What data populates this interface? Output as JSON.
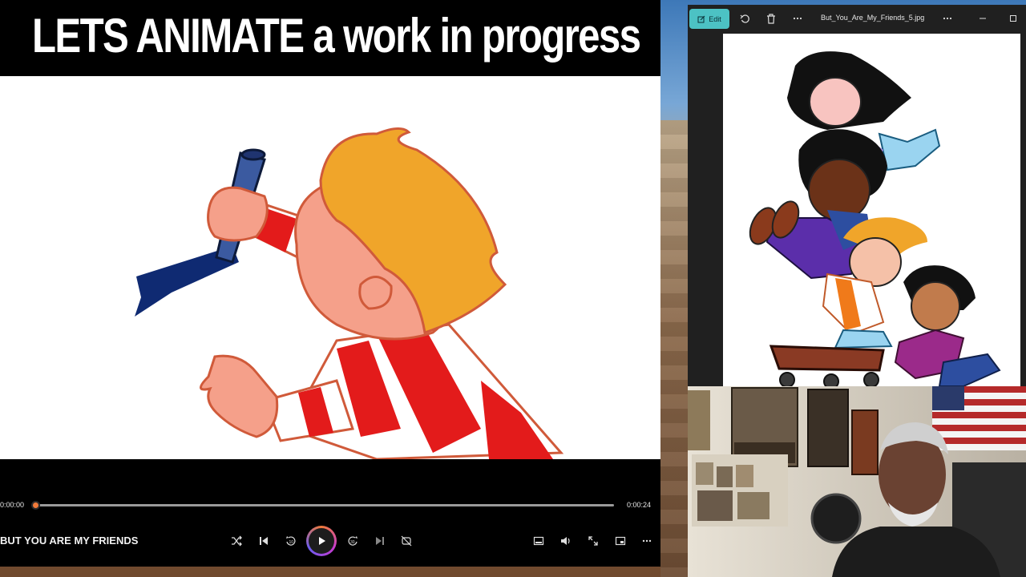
{
  "player": {
    "banner_title": "LETS ANIMATE a work in progress",
    "current_time": "0:00:00",
    "duration": "0:00:24",
    "progress_fraction": 0.0,
    "track_title": "BUT YOU ARE MY FRIENDS",
    "accent_color": "#f07a3a"
  },
  "photos_app": {
    "edit_label": "Edit",
    "file_name": "But_You_Are_My_Friends_5.jpg",
    "accent_color": "#4cc2c4"
  },
  "icons": {
    "shuffle": "shuffle-icon",
    "previous": "previous-icon",
    "rewind": "rewind-10-icon",
    "play": "play-icon",
    "forward": "forward-30-icon",
    "next": "next-icon",
    "repeat": "repeat-icon",
    "miniplayer": "miniplayer-icon",
    "volume": "volume-icon",
    "fullscreen": "fullscreen-icon",
    "cast": "cast-icon",
    "more": "more-icon"
  }
}
